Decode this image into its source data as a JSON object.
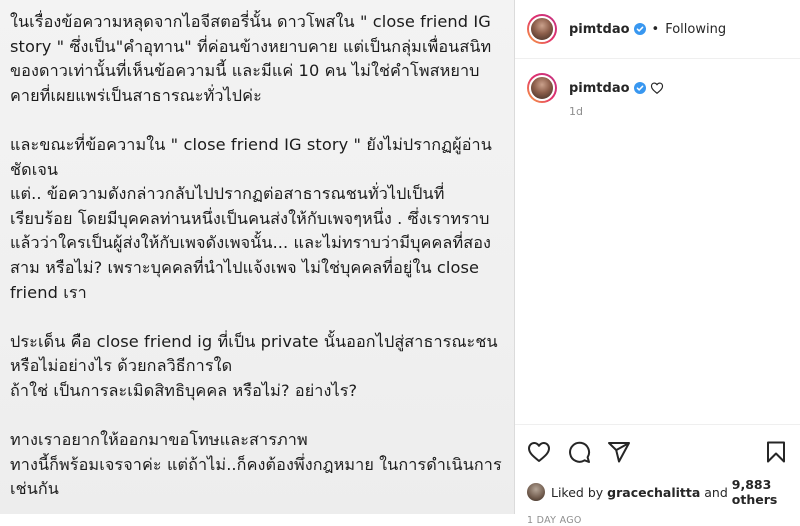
{
  "post": {
    "text": "ในเรื่องข้อความหลุดจากไอจีสตอรี่นั้น ดาวโพสใน \" close friend IG\nstory \" ซึ่งเป็น\"คำอุทาน\" ที่ค่อนข้างหยาบคาย แต่เป็นกลุ่มเพื่อนสนิท\nของดาวเท่านั้นที่เห็นข้อความนี้ และมีแค่ 10 คน ไม่ใช่คำโพสหยาบ\nคายที่เผยแพร่เป็นสาธารณะทั่วไปค่ะ\n\nและขณะที่ข้อความใน \" close friend IG story \" ยังไม่ปรากฏผู้อ่าน\nชัดเจน\nแต่.. ข้อความดังกล่าวกลับไปปรากฏต่อสาธารณชนทั่วไปเป็นที่\nเรียบร้อย โดยมีบุคคลท่านหนึ่งเป็นคนส่งให้กับเพจๆหนึ่ง . ซึ่งเราทราบ\nแล้วว่าใครเป็นผู้ส่งให้กับเพจดังเพจนั้น... และไม่ทราบว่ามีบุคคลที่สอง\nสาม หรือไม่? เพราะบุคคลที่นำไปแจ้งเพจ ไม่ใช่บุคคลที่อยู่ใน close\nfriend เรา\n\nประเด็น คือ close friend ig ที่เป็น private นั้นออกไปสู่สาธารณะชน\nหรือไม่อย่างไร ด้วยกลวิธีการใด\nถ้าใช่ เป็นการละเมิดสิทธิบุคคล หรือไม่? อย่างไร?\n\nทางเราอยากให้ออกมาขอโทษและสารภาพ\nทางนี้ก็พร้อมเจรจาค่ะ แต่ถ้าไม่..ก็คงต้องพึ่งกฎหมาย ในการดำเนินการ\nเช่นกัน"
  },
  "header": {
    "username": "pimtdao",
    "separator": "•",
    "follow_status": "Following"
  },
  "caption": {
    "username": "pimtdao",
    "time": "1d"
  },
  "likes": {
    "prefix": "Liked by ",
    "user": "gracechalitta",
    "middle": " and ",
    "others": "9,883 others"
  },
  "timestamp": "1 DAY AGO",
  "icons": [
    "verified-badge-icon",
    "heart-icon",
    "comment-icon",
    "share-icon",
    "bookmark-icon"
  ],
  "colors": {
    "verified": "#3897f0",
    "text": "#262626",
    "muted": "#8e8e8e"
  }
}
